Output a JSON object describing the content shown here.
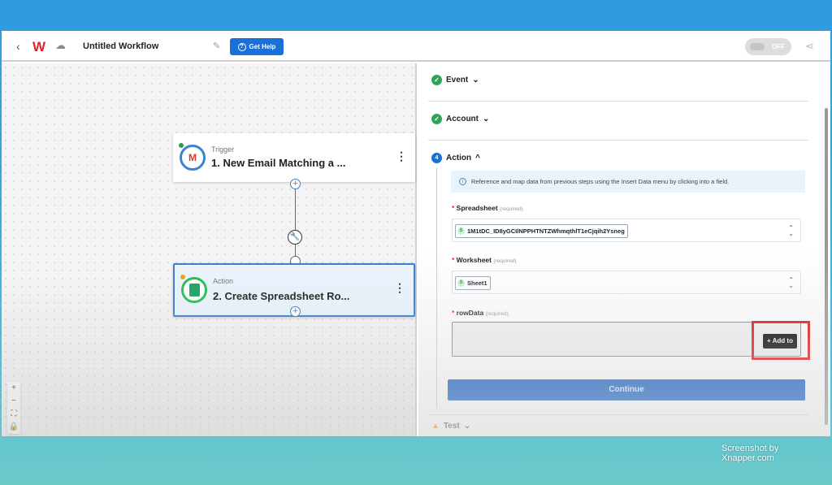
{
  "header": {
    "title": "Untitled Workflow",
    "help_label": "Get Help",
    "toggle_label": "OFF",
    "logo": "W"
  },
  "canvas": {
    "nodes": [
      {
        "type": "Trigger",
        "name": "1. New Email Matching a ...",
        "app": "M"
      },
      {
        "type": "Action",
        "name": "2. Create Spreadsheet Ro..."
      }
    ],
    "zoom_controls": [
      "+",
      "−",
      "⛶",
      "🔒"
    ]
  },
  "panel": {
    "sections": {
      "event": "Event",
      "account": "Account",
      "action": "Action",
      "action_step": "4",
      "test": "Test"
    },
    "info": "Reference and map data from previous steps using the Insert Data menu by clicking into a field.",
    "fields": [
      {
        "label": "Spreadsheet",
        "required": "(required)",
        "value": "1M1tDC_ID8yGCIlNPPHTNTZWhmqthlT1eCjqih2Ysneg"
      },
      {
        "label": "Worksheet",
        "required": "(required)",
        "value": "Sheet1"
      },
      {
        "label": "rowData",
        "required": "(required)",
        "value": ""
      }
    ],
    "add_button": "+ Add to",
    "continue_label": "Continue"
  },
  "watermark": "Screenshot by Xnapper.com",
  "colors": {
    "primary": "#1a6fd8",
    "success": "#2fa55a",
    "highlight": "#e31010"
  }
}
